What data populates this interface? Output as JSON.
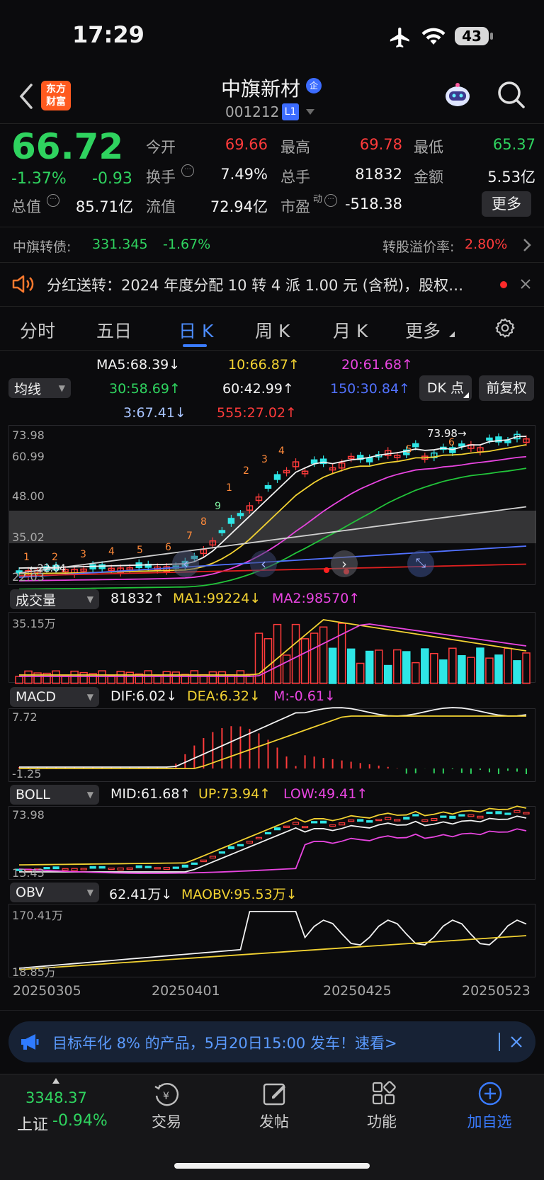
{
  "status_bar": {
    "time": "17:29",
    "battery": "43"
  },
  "header": {
    "app_logo_line1": "东方",
    "app_logo_line2": "财富",
    "stock_name": "中旗新材",
    "enterprise_badge": "企",
    "stock_code": "001212",
    "level_badge": "L1"
  },
  "quote": {
    "price": "66.72",
    "change_pct": "-1.37%",
    "change_val": "-0.93",
    "open_label": "今开",
    "open_value": "69.66",
    "high_label": "最高",
    "high_value": "69.78",
    "low_label": "最低",
    "low_value": "65.37",
    "turnover_label": "换手",
    "turnover_value": "7.49%",
    "volume_label": "总手",
    "volume_value": "81832",
    "amount_label": "金额",
    "amount_value": "5.53亿",
    "mktcap_label": "总值",
    "mktcap_value": "85.71亿",
    "float_label": "流值",
    "float_value": "72.94亿",
    "pe_label": "市盈",
    "pe_sup": "动",
    "pe_value": "-518.38",
    "more_button": "更多"
  },
  "bond": {
    "label": "中旗转债:",
    "price": "331.345",
    "change": "-1.67%",
    "premium_label": "转股溢价率:",
    "premium_value": "2.80%"
  },
  "notice": {
    "text": "分红送转：2024 年度分配 10 转 4 派 1.00 元 (含税)，股权…"
  },
  "tabs": {
    "items": [
      "分时",
      "五日",
      "日 K",
      "周 K",
      "月 K",
      "更多"
    ],
    "active": "日 K"
  },
  "ma_panel": {
    "selector": "均线",
    "ma5": "MA5:68.39↓",
    "ma10": "10:66.87↑",
    "ma20": "20:61.68↑",
    "ma30": "30:58.69↑",
    "ma60": "60:42.99↑",
    "ma150": "150:30.84↑",
    "ma3": "3:67.41↓",
    "ma555": "555:27.02↑",
    "dk_button": "DK 点",
    "adjust_button": "前复权"
  },
  "kline": {
    "y_labels": [
      "73.98",
      "60.99",
      "48.00",
      "35.02",
      "22.03"
    ],
    "max_marker": "73.98",
    "min_marker": "22.04",
    "td_counts": [
      "1",
      "2",
      "3",
      "4",
      "5",
      "6",
      "7",
      "8",
      "9"
    ]
  },
  "volume_panel": {
    "selector": "成交量",
    "vol": "81832↑",
    "ma1": "MA1:99224↓",
    "ma2": "MA2:98570↑",
    "y_max": "35.15万"
  },
  "macd_panel": {
    "selector": "MACD",
    "dif": "DIF:6.02↓",
    "dea": "DEA:6.32↓",
    "m": "M:-0.61↓",
    "y_max": "7.72",
    "y_min": "-1.25"
  },
  "boll_panel": {
    "selector": "BOLL",
    "mid": "MID:61.68↑",
    "up": "UP:73.94↑",
    "low": "LOW:49.41↑",
    "y_max": "73.98",
    "y_min": "13.43"
  },
  "obv_panel": {
    "selector": "OBV",
    "obv": "62.41万↓",
    "maobv": "MAOBV:95.53万↓",
    "y_max": "170.41万",
    "y_min": "18.85万"
  },
  "x_axis": {
    "dates": [
      "20250305",
      "20250401",
      "20250425",
      "20250523"
    ]
  },
  "banner": {
    "text": "目标年化 8% 的产品，5月20日15:00 发车！速看>"
  },
  "bottom_nav": {
    "index_value": "3348.37",
    "index_name": "上证",
    "index_change": "-0.94%",
    "trade": "交易",
    "post": "发帖",
    "functions": "功能",
    "add_watch": "加自选"
  },
  "colors": {
    "up": "#ff3b3b",
    "down": "#2fd35f",
    "cyan_candle": "#2ee6e6",
    "ma5": "#f2f2f2",
    "ma10": "#f2d232",
    "ma20": "#e845e0",
    "ma30": "#22c43a",
    "ma60": "#cfcfcf",
    "ma150": "#5272ff",
    "ma555": "#e02020",
    "accent": "#3a7bff"
  }
}
